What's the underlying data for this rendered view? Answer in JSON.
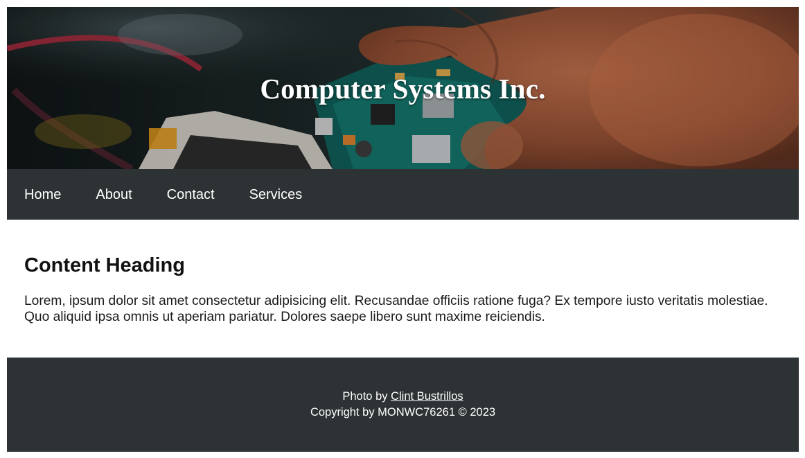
{
  "hero": {
    "title": "Computer Systems Inc.",
    "image": "photo of hands holding an electronic circuit board"
  },
  "nav": {
    "items": [
      {
        "label": "Home"
      },
      {
        "label": "About"
      },
      {
        "label": "Contact"
      },
      {
        "label": "Services"
      }
    ]
  },
  "main": {
    "heading": "Content Heading",
    "paragraph": "Lorem, ipsum dolor sit amet consectetur adipisicing elit. Recusandae officiis ratione fuga? Ex tempore iusto veritatis molestiae. Quo aliquid ipsa omnis ut aperiam pariatur. Dolores saepe libero sunt maxime reiciendis."
  },
  "footer": {
    "photo_prefix": "Photo by",
    "photo_credit_link": "Clint Bustrillos",
    "copyright": "Copyright by MONWC76261 © 2023"
  },
  "colors": {
    "bar_background": "#2d3235",
    "bar_text": "#ffffff",
    "page_background": "#ffffff"
  }
}
